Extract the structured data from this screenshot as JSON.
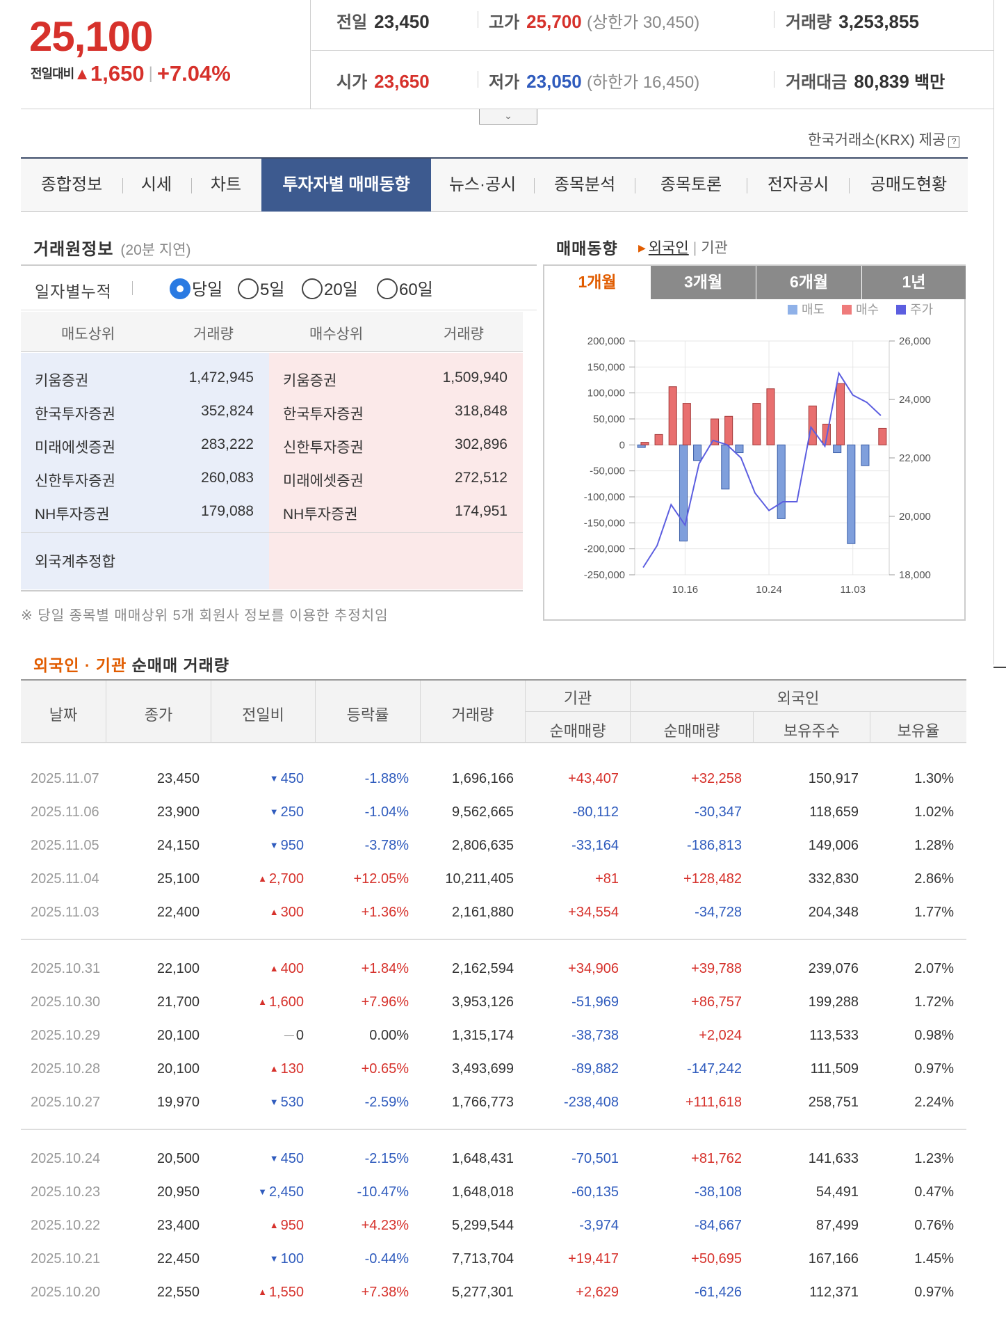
{
  "summary": {
    "price": "25,100",
    "change_label": "전일대비",
    "change_icon": "triangle-up-icon",
    "change_value": "1,650",
    "change_rate": "+7.04%",
    "prev_close_label": "전일",
    "prev_close": "23,450",
    "high_label": "고가",
    "high": "25,700",
    "upper_limit": "(상한가 30,450)",
    "volume_label": "거래량",
    "volume": "3,253,855",
    "open_label": "시가",
    "open": "23,650",
    "low_label": "저가",
    "low": "23,050",
    "lower_limit": "(하한가 16,450)",
    "amount_label": "거래대금",
    "amount": "80,839",
    "amount_unit": "백만"
  },
  "provider": {
    "text": "한국거래소(KRX) 제공",
    "icon": "info-icon"
  },
  "tabs": [
    {
      "label": "종합정보"
    },
    {
      "label": "시세"
    },
    {
      "label": "차트"
    },
    {
      "label": "투자자별 매매동향",
      "active": true
    },
    {
      "label": "뉴스·공시"
    },
    {
      "label": "종목분석"
    },
    {
      "label": "종목토론"
    },
    {
      "label": "전자공시"
    },
    {
      "label": "공매도현황"
    }
  ],
  "broker": {
    "title": "거래원정보",
    "subtitle": "(20분 지연)",
    "period_label": "일자별누적",
    "periods": [
      {
        "label": "당일",
        "selected": true
      },
      {
        "label": "5일"
      },
      {
        "label": "20일"
      },
      {
        "label": "60일"
      }
    ],
    "headers": {
      "sell_top": "매도상위",
      "sell_vol": "거래량",
      "buy_top": "매수상위",
      "buy_vol": "거래량"
    },
    "sell": [
      {
        "name": "키움증권",
        "vol": "1,472,945"
      },
      {
        "name": "한국투자증권",
        "vol": "352,824"
      },
      {
        "name": "미래에셋증권",
        "vol": "283,222"
      },
      {
        "name": "신한투자증권",
        "vol": "260,083"
      },
      {
        "name": "NH투자증권",
        "vol": "179,088"
      }
    ],
    "buy": [
      {
        "name": "키움증권",
        "vol": "1,509,940"
      },
      {
        "name": "한국투자증권",
        "vol": "318,848"
      },
      {
        "name": "신한투자증권",
        "vol": "302,896"
      },
      {
        "name": "미래에셋증권",
        "vol": "272,512"
      },
      {
        "name": "NH투자증권",
        "vol": "174,951"
      }
    ],
    "foreign_total_label": "외국계추정합",
    "note": "※ 당일 종목별 매매상위 5개 회원사 정보를 이용한 추정치임"
  },
  "trend": {
    "title": "매매동향",
    "link_foreign": "외국인",
    "link_inst": "기관",
    "chart_tabs": [
      {
        "label": "1개월",
        "active": true
      },
      {
        "label": "3개월"
      },
      {
        "label": "6개월"
      },
      {
        "label": "1년"
      }
    ]
  },
  "chart_data": {
    "type": "bar",
    "title": "",
    "legend": [
      {
        "name": "매도",
        "color": "#8fb1e8"
      },
      {
        "name": "매수",
        "color": "#ef7b7b"
      },
      {
        "name": "주가",
        "color": "#5c5ee0"
      }
    ],
    "legend_position": "top-right",
    "y_left": {
      "min": -250000,
      "max": 200000,
      "ticks": [
        "200,000",
        "150,000",
        "100,000",
        "50,000",
        "0",
        "-50,000",
        "-100,000",
        "-150,000",
        "-200,000",
        "-250,000"
      ]
    },
    "y_right": {
      "min": 18000,
      "max": 26000,
      "ticks": [
        "26,000",
        "24,000",
        "22,000",
        "20,000",
        "18,000"
      ]
    },
    "x_ticks": [
      {
        "label": "10.16",
        "index": 3
      },
      {
        "label": "10.24",
        "index": 9
      },
      {
        "label": "11.03",
        "index": 15
      }
    ],
    "grid": true,
    "sell": [
      -5000,
      0,
      0,
      -185000,
      -30000,
      0,
      -85000,
      -15000,
      0,
      0,
      -142000,
      0,
      0,
      0,
      -15000,
      -190000,
      -40000,
      0
    ],
    "buy": [
      5000,
      20000,
      112000,
      80000,
      0,
      50000,
      55000,
      0,
      80000,
      108000,
      0,
      0,
      75000,
      40000,
      118000,
      0,
      0,
      32000
    ],
    "price": [
      18250,
      19000,
      20400,
      19700,
      21800,
      22600,
      22450,
      22000,
      20800,
      20200,
      20500,
      20500,
      23050,
      22400,
      24900,
      24150,
      23900,
      23450
    ]
  },
  "net": {
    "title_highlight": "외국인 · 기관",
    "title_rest": "순매매 거래량",
    "headers": {
      "date": "날짜",
      "close": "종가",
      "diff": "전일비",
      "rate": "등락률",
      "volume": "거래량",
      "inst": "기관",
      "foreign": "외국인",
      "inst_net": "순매매량",
      "foreign_net": "순매매량",
      "holdings": "보유주수",
      "ratio": "보유율"
    },
    "rows": [
      {
        "date": "2025.11.07",
        "close": "23,450",
        "dir": "down",
        "diff": "450",
        "rate": "-1.88%",
        "vol": "1,696,166",
        "inst": "+43,407",
        "frn": "+32,258",
        "hold": "150,917",
        "ratio": "1.30%"
      },
      {
        "date": "2025.11.06",
        "close": "23,900",
        "dir": "down",
        "diff": "250",
        "rate": "-1.04%",
        "vol": "9,562,665",
        "inst": "-80,112",
        "frn": "-30,347",
        "hold": "118,659",
        "ratio": "1.02%"
      },
      {
        "date": "2025.11.05",
        "close": "24,150",
        "dir": "down",
        "diff": "950",
        "rate": "-3.78%",
        "vol": "2,806,635",
        "inst": "-33,164",
        "frn": "-186,813",
        "hold": "149,006",
        "ratio": "1.28%"
      },
      {
        "date": "2025.11.04",
        "close": "25,100",
        "dir": "up",
        "diff": "2,700",
        "rate": "+12.05%",
        "vol": "10,211,405",
        "inst": "+81",
        "frn": "+128,482",
        "hold": "332,830",
        "ratio": "2.86%"
      },
      {
        "date": "2025.11.03",
        "close": "22,400",
        "dir": "up",
        "diff": "300",
        "rate": "+1.36%",
        "vol": "2,161,880",
        "inst": "+34,554",
        "frn": "-34,728",
        "hold": "204,348",
        "ratio": "1.77%"
      },
      {
        "date": "2025.10.31",
        "close": "22,100",
        "dir": "up",
        "diff": "400",
        "rate": "+1.84%",
        "vol": "2,162,594",
        "inst": "+34,906",
        "frn": "+39,788",
        "hold": "239,076",
        "ratio": "2.07%"
      },
      {
        "date": "2025.10.30",
        "close": "21,700",
        "dir": "up",
        "diff": "1,600",
        "rate": "+7.96%",
        "vol": "3,953,126",
        "inst": "-51,969",
        "frn": "+86,757",
        "hold": "199,288",
        "ratio": "1.72%"
      },
      {
        "date": "2025.10.29",
        "close": "20,100",
        "dir": "flat",
        "diff": "0",
        "rate": "0.00%",
        "vol": "1,315,174",
        "inst": "-38,738",
        "frn": "+2,024",
        "hold": "113,533",
        "ratio": "0.98%"
      },
      {
        "date": "2025.10.28",
        "close": "20,100",
        "dir": "up",
        "diff": "130",
        "rate": "+0.65%",
        "vol": "3,493,699",
        "inst": "-89,882",
        "frn": "-147,242",
        "hold": "111,509",
        "ratio": "0.97%"
      },
      {
        "date": "2025.10.27",
        "close": "19,970",
        "dir": "down",
        "diff": "530",
        "rate": "-2.59%",
        "vol": "1,766,773",
        "inst": "-238,408",
        "frn": "+111,618",
        "hold": "258,751",
        "ratio": "2.24%"
      },
      {
        "date": "2025.10.24",
        "close": "20,500",
        "dir": "down",
        "diff": "450",
        "rate": "-2.15%",
        "vol": "1,648,431",
        "inst": "-70,501",
        "frn": "+81,762",
        "hold": "141,633",
        "ratio": "1.23%"
      },
      {
        "date": "2025.10.23",
        "close": "20,950",
        "dir": "down",
        "diff": "2,450",
        "rate": "-10.47%",
        "vol": "1,648,018",
        "inst": "-60,135",
        "frn": "-38,108",
        "hold": "54,491",
        "ratio": "0.47%"
      },
      {
        "date": "2025.10.22",
        "close": "23,400",
        "dir": "up",
        "diff": "950",
        "rate": "+4.23%",
        "vol": "5,299,544",
        "inst": "-3,974",
        "frn": "-84,667",
        "hold": "87,499",
        "ratio": "0.76%"
      },
      {
        "date": "2025.10.21",
        "close": "22,450",
        "dir": "down",
        "diff": "100",
        "rate": "-0.44%",
        "vol": "7,713,704",
        "inst": "+19,417",
        "frn": "+50,695",
        "hold": "167,166",
        "ratio": "1.45%"
      },
      {
        "date": "2025.10.20",
        "close": "22,550",
        "dir": "up",
        "diff": "1,550",
        "rate": "+7.38%",
        "vol": "5,277,301",
        "inst": "+2,629",
        "frn": "-61,426",
        "hold": "112,371",
        "ratio": "0.97%"
      }
    ]
  }
}
